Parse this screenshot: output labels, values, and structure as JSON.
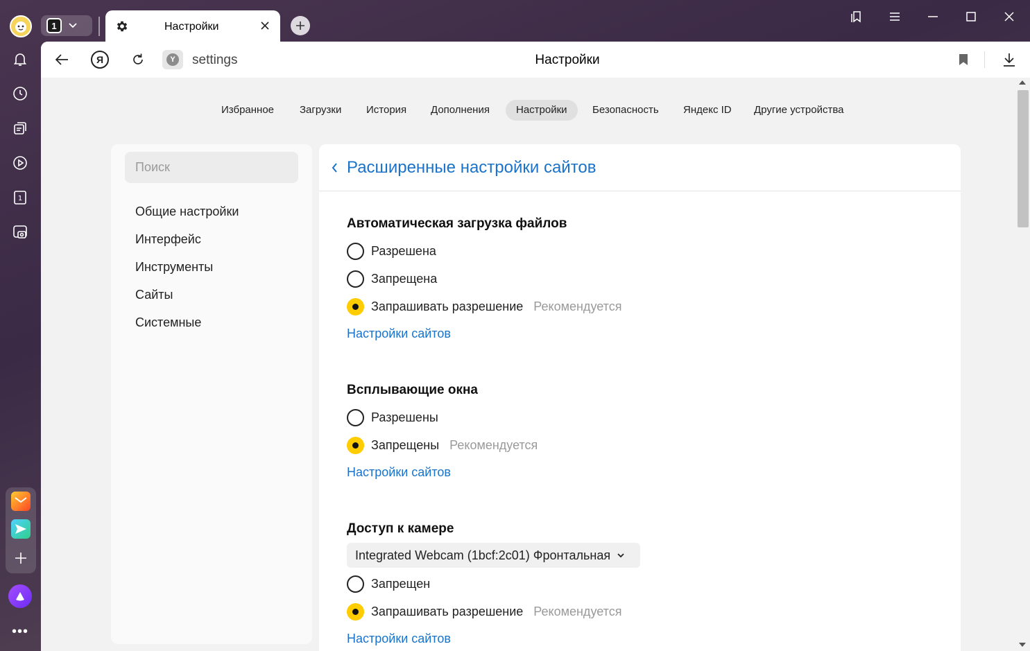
{
  "tab": {
    "title": "Настройки",
    "counter": "1"
  },
  "addressbar": {
    "url": "settings",
    "page_title": "Настройки",
    "ya_label": "Я",
    "site_letter": "Y"
  },
  "topnav": [
    {
      "label": "Избранное"
    },
    {
      "label": "Загрузки"
    },
    {
      "label": "История"
    },
    {
      "label": "Дополнения"
    },
    {
      "label": "Настройки",
      "active": true
    },
    {
      "label": "Безопасность"
    },
    {
      "label": "Яндекс ID"
    },
    {
      "label": "Другие устройства"
    }
  ],
  "leftpanel": {
    "search_placeholder": "Поиск",
    "items": [
      {
        "label": "Общие настройки"
      },
      {
        "label": "Интерфейс"
      },
      {
        "label": "Инструменты"
      },
      {
        "label": "Сайты"
      },
      {
        "label": "Системные"
      }
    ]
  },
  "main": {
    "title": "Расширенные настройки сайтов",
    "sections": [
      {
        "title": "Автоматическая загрузка файлов",
        "options": [
          {
            "label": "Разрешена",
            "selected": false
          },
          {
            "label": "Запрещена",
            "selected": false
          },
          {
            "label": "Запрашивать разрешение",
            "selected": true,
            "note": "Рекомендуется"
          }
        ],
        "link": "Настройки сайтов"
      },
      {
        "title": "Всплывающие окна",
        "options": [
          {
            "label": "Разрешены",
            "selected": false
          },
          {
            "label": "Запрещены",
            "selected": true,
            "note": "Рекомендуется"
          }
        ],
        "link": "Настройки сайтов"
      },
      {
        "title": "Доступ к камере",
        "device": "Integrated Webcam (1bcf:2c01) Фронтальная",
        "options": [
          {
            "label": "Запрещен",
            "selected": false
          },
          {
            "label": "Запрашивать разрешение",
            "selected": true,
            "note": "Рекомендуется"
          }
        ],
        "link": "Настройки сайтов"
      }
    ]
  },
  "icons": {
    "sidebar": [
      "avatar",
      "bell-icon",
      "history-clock-icon",
      "collections-icon",
      "video-play-icon",
      "tab-counter-icon",
      "screenshot-camera-icon",
      "mail-app-icon",
      "messenger-app-icon",
      "add-app-icon",
      "alice-assistant-icon",
      "more-icon"
    ]
  },
  "colors": {
    "accent_link": "#1a73c9",
    "radio_selected": "#ffcc00"
  }
}
